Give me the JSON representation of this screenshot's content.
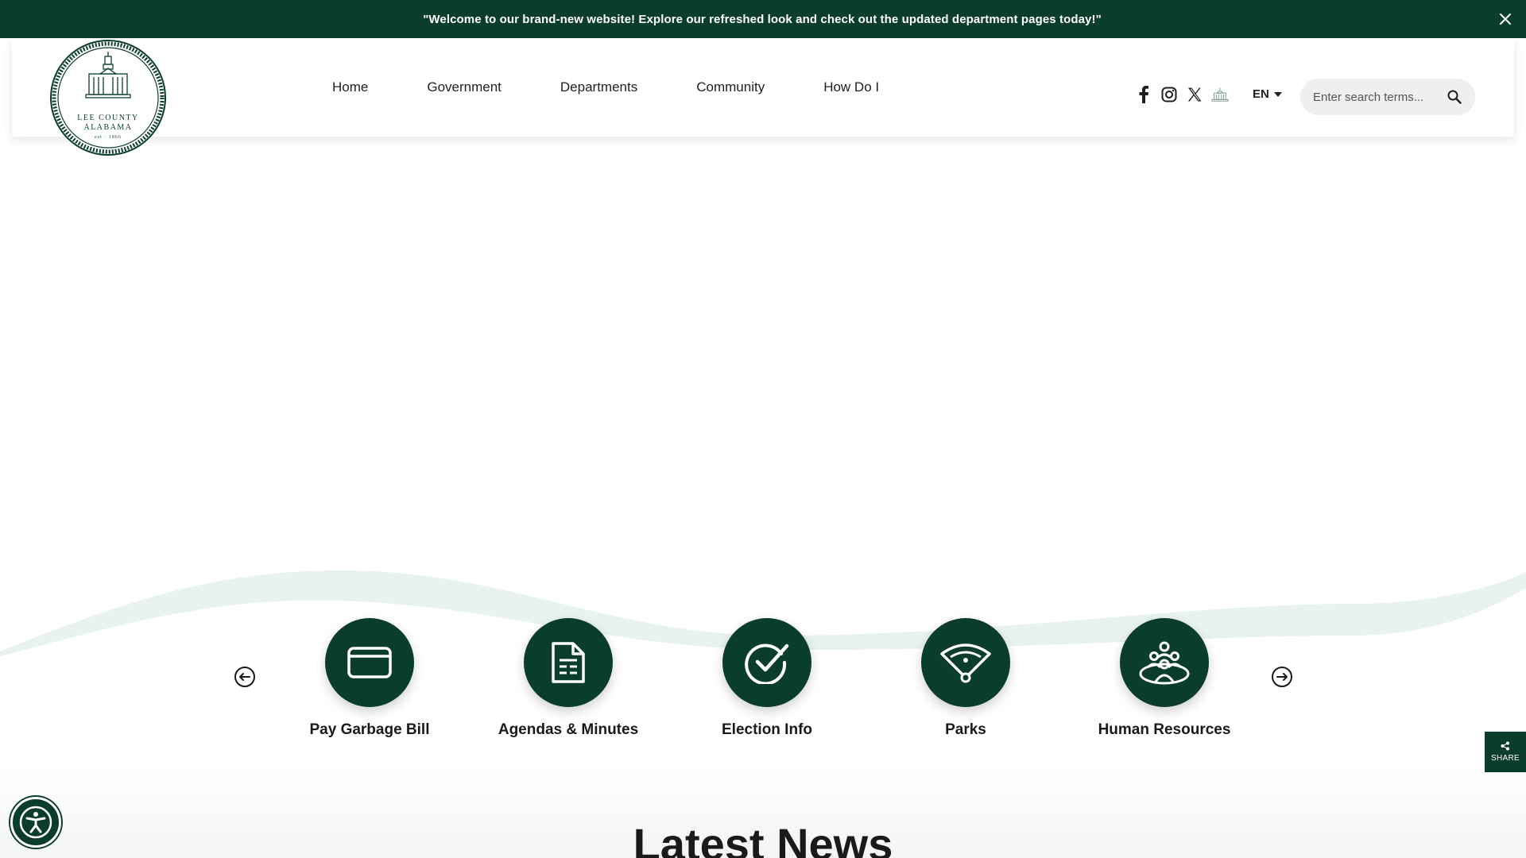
{
  "alert": {
    "message": "\"Welcome to our brand-new website! Explore our refreshed look and check out the updated department pages today!\""
  },
  "logo": {
    "line1": "LEE COUNTY",
    "line2": "ALABAMA",
    "line3": "est · 1866"
  },
  "nav": {
    "items": [
      {
        "label": "Home"
      },
      {
        "label": "Government"
      },
      {
        "label": "Departments"
      },
      {
        "label": "Community"
      },
      {
        "label": "How Do I"
      }
    ]
  },
  "socials": [
    "facebook-icon",
    "instagram-icon",
    "x-twitter-icon",
    "capitol-icon"
  ],
  "language": {
    "selected": "EN"
  },
  "search": {
    "placeholder": "Enter search terms..."
  },
  "quick_links": [
    {
      "label": "Pay Garbage Bill",
      "icon": "credit-card-icon"
    },
    {
      "label": "Agendas & Minutes",
      "icon": "document-icon"
    },
    {
      "label": "Election Info",
      "icon": "checkmark-icon"
    },
    {
      "label": "Parks",
      "icon": "baseball-field-icon"
    },
    {
      "label": "Human Resources",
      "icon": "people-group-icon"
    }
  ],
  "news": {
    "title": "Latest News"
  },
  "share": {
    "label": "SHARE"
  },
  "colors": {
    "brand": "#0b3d2e",
    "wave": "#e8f2ef"
  }
}
